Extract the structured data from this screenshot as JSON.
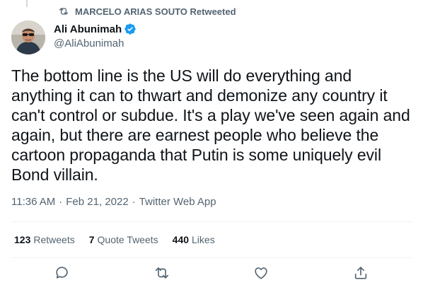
{
  "retweet": {
    "text": "MARCELO ARIAS SOUTO Retweeted",
    "icon": "retweet-icon"
  },
  "author": {
    "name": "Ali Abunimah",
    "handle": "@AliAbunimah",
    "verified": true,
    "verified_color": "#1d9bf0"
  },
  "tweet": {
    "text": "The bottom line is the US will do everything and anything it can to thwart and demonize any country it can't control or subdue. It's a play we've seen again and again, but there are earnest people who believe the cartoon propaganda that Putin is some uniquely evil Bond villain.",
    "time": "11:36 AM",
    "date": "Feb 21, 2022",
    "source": "Twitter Web App",
    "separator": "·"
  },
  "stats": {
    "retweets": {
      "count": "123",
      "label": "Retweets"
    },
    "quote_tweets": {
      "count": "7",
      "label": "Quote Tweets"
    },
    "likes": {
      "count": "440",
      "label": "Likes"
    }
  },
  "actions": {
    "reply": "reply-icon",
    "retweet": "retweet-icon",
    "like": "heart-icon",
    "share": "share-icon"
  },
  "colors": {
    "text": "#0f1419",
    "secondary": "#536471",
    "divider": "#eff3f4"
  }
}
